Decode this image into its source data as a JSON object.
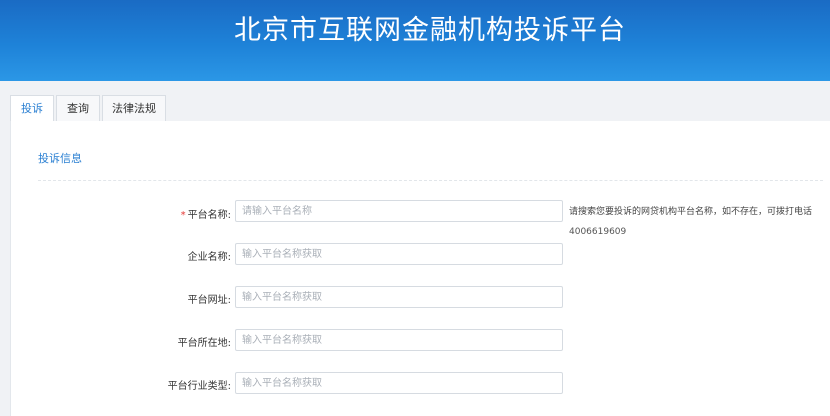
{
  "header": {
    "title": "北京市互联网金融机构投诉平台"
  },
  "tabs": [
    {
      "label": "投诉",
      "active": true
    },
    {
      "label": "查询",
      "active": false
    },
    {
      "label": "法律法规",
      "active": false
    }
  ],
  "section": {
    "title": "投诉信息"
  },
  "form": {
    "fields": [
      {
        "label": "平台名称:",
        "required": true,
        "placeholder": "请输入平台名称",
        "value": ""
      },
      {
        "label": "企业名称:",
        "required": false,
        "placeholder": "输入平台名称获取",
        "value": ""
      },
      {
        "label": "平台网址:",
        "required": false,
        "placeholder": "输入平台名称获取",
        "value": ""
      },
      {
        "label": "平台所在地:",
        "required": false,
        "placeholder": "输入平台名称获取",
        "value": ""
      },
      {
        "label": "平台行业类型:",
        "required": false,
        "placeholder": "输入平台名称获取",
        "value": ""
      }
    ],
    "required_mark": "*",
    "hint": {
      "text": "请搜索您要投诉的网贷机构平台名称，如不存在，可拨打电话",
      "phone": "4006619609"
    }
  },
  "colors": {
    "header_top": "#1a6bc4",
    "header_bottom": "#2b97e6",
    "accent": "#2a7fd2",
    "required": "#e53935"
  }
}
